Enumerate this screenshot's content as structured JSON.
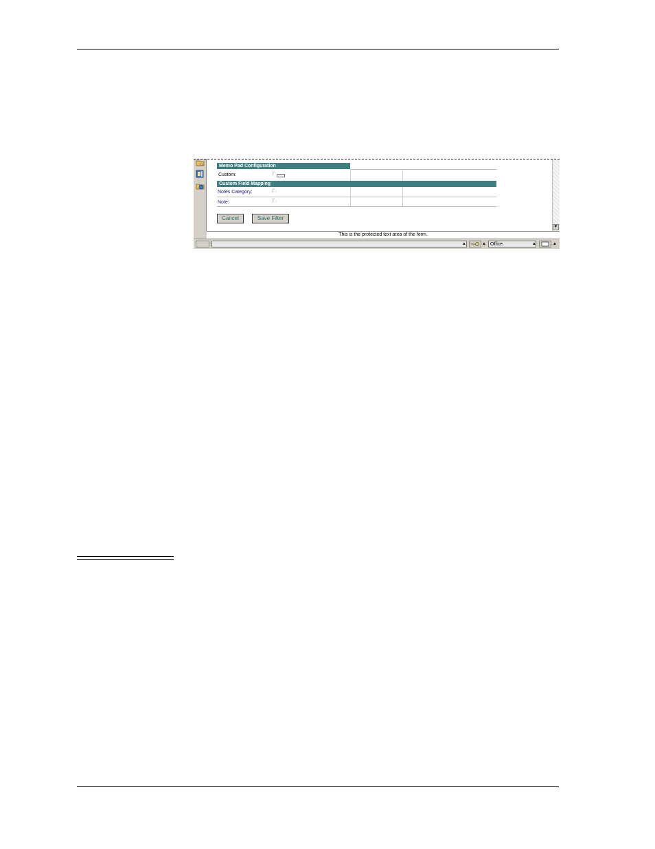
{
  "memo_pad": {
    "header": "Memo Pad Configuration",
    "custom_label": "Custom:"
  },
  "custom_field_mapping": {
    "header": "Custom Field Mapping",
    "notes_category_label": "Notes Category:",
    "note_label": "Note:"
  },
  "buttons": {
    "cancel": "Cancel",
    "save_filter": "Save Filter"
  },
  "protected_text": "This is the protected text area of the form.",
  "statusbar": {
    "location": "Office"
  },
  "colors": {
    "section_header_bg": "#3f7f7f",
    "button_text": "#2a6f6f"
  }
}
